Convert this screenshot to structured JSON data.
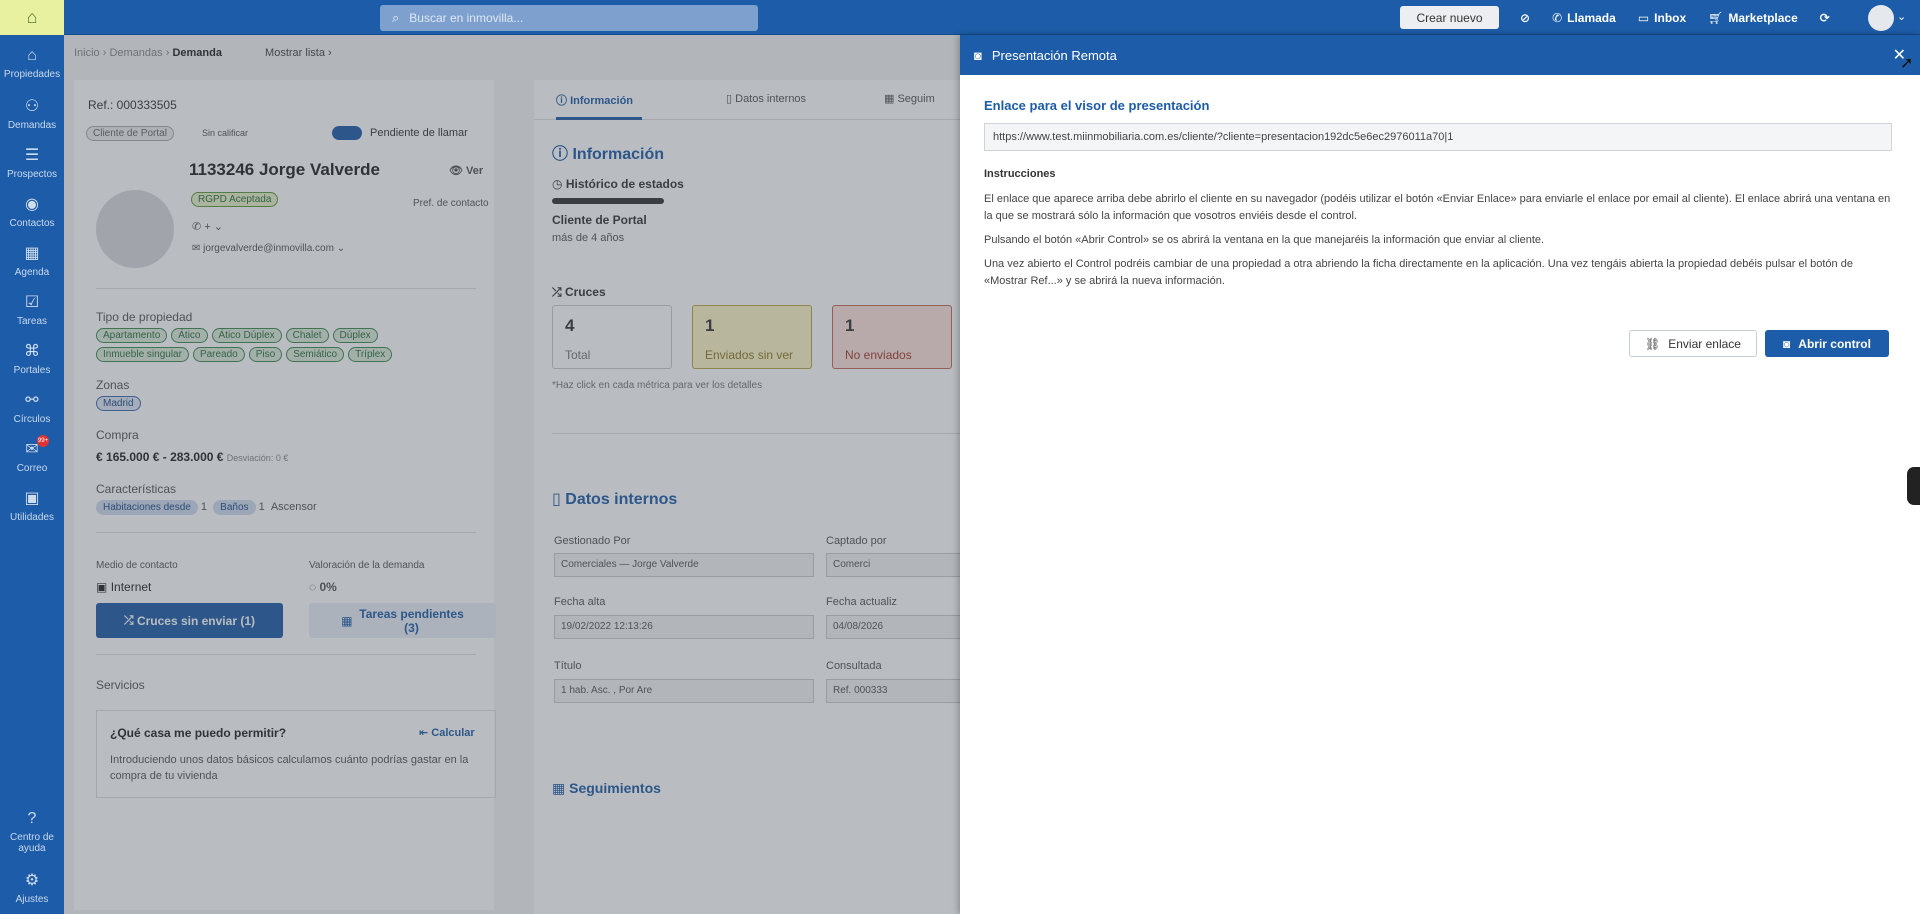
{
  "topbar": {
    "search_placeholder": "Buscar en inmovilla...",
    "create_label": "Crear nuevo",
    "actions": [
      {
        "icon": "eye-off-icon",
        "label": ""
      },
      {
        "icon": "phone-icon",
        "label": "Llamada"
      },
      {
        "icon": "inbox-icon",
        "label": "Inbox"
      },
      {
        "icon": "cart-icon",
        "label": "Marketplace"
      },
      {
        "icon": "sync-icon",
        "label": ""
      }
    ]
  },
  "sidebar": {
    "items": [
      {
        "icon": "home-icon",
        "label": "Propiedades"
      },
      {
        "icon": "users-icon",
        "label": "Demandas"
      },
      {
        "icon": "list-icon",
        "label": "Prospectos"
      },
      {
        "icon": "user-circle-icon",
        "label": "Contactos"
      },
      {
        "icon": "calendar-icon",
        "label": "Agenda"
      },
      {
        "icon": "tasks-icon",
        "label": "Tareas"
      },
      {
        "icon": "portal-icon",
        "label": "Portales"
      },
      {
        "icon": "circles-icon",
        "label": "Círculos"
      },
      {
        "icon": "mail-icon",
        "label": "Correo",
        "badge": "99+"
      },
      {
        "icon": "toolbox-icon",
        "label": "Utilidades"
      }
    ],
    "bottom": [
      {
        "icon": "help-icon",
        "label_line1": "Centro de",
        "label_line2": "ayuda"
      },
      {
        "icon": "gear-icon",
        "label": "Ajustes"
      }
    ]
  },
  "breadcrumb": {
    "part1": "Inicio",
    "part2": "Demandas",
    "current": "Demanda",
    "list_link": "Mostrar lista"
  },
  "demand": {
    "ref": "Ref.: 000333505",
    "client_tag": "Cliente de Portal",
    "rating": "Sin calificar",
    "pending_call": "Pendiente de llamar",
    "name": "1133246 Jorge Valverde",
    "view": "Ver",
    "rgpd": "RGPD Aceptada",
    "phone": "+",
    "email": "jorgevalverde@inmovilla.com",
    "pref_contact": "Pref. de contacto",
    "property_type_label": "Tipo de propiedad",
    "property_types": [
      "Apartamento",
      "Ático",
      "Ático Dúplex",
      "Chalet",
      "Dúplex",
      "Inmueble singular",
      "Pareado",
      "Piso",
      "Semiático",
      "Tríplex"
    ],
    "zones_label": "Zonas",
    "zone": "Madrid",
    "purchase_label": "Compra",
    "price_range": "165.000 € - 283.000 €",
    "deviation": "Desviación: 0 €",
    "features_label": "Características",
    "feature_rooms": "Habitaciones desde",
    "feature_rooms_val": "1",
    "feature_baths": "Baños",
    "feature_baths_val": "1",
    "feature_lift": "Ascensor",
    "contact_medium_label": "Medio de contacto",
    "contact_medium": "Internet",
    "valuation_label": "Valoración de la demanda",
    "valuation": "0%",
    "btn_cruces": "Cruces sin enviar  (1)",
    "btn_tareas_l1": "Tareas pendientes",
    "btn_tareas_l2": "(3)",
    "services_label": "Servicios",
    "afford_title": "¿Qué casa me puedo permitir?",
    "afford_calc": "Calcular",
    "afford_text": "Introduciendo unos datos básicos calculamos cuánto podrías gastar en la compra de tu vivienda"
  },
  "info": {
    "tabs": [
      "Información",
      "Datos internos",
      "Seguim"
    ],
    "title": "Información",
    "history_title": "Histórico de estados",
    "status": "Cliente de Portal",
    "status_time": "más de 4 años",
    "cruces_title": "Cruces",
    "metrics": [
      {
        "num": "4",
        "label": "Total"
      },
      {
        "num": "1",
        "label": "Enviados sin ver"
      },
      {
        "num": "1",
        "label": "No enviados"
      }
    ],
    "metrics_hint": "*Haz click en cada métrica para ver los detalles",
    "internal_title": "Datos internos",
    "managed_label": "Gestionado Por",
    "managed_value": "Comerciales — Jorge Valverde",
    "captured_label": "Captado por",
    "captured_value": "Comerci",
    "created_label": "Fecha alta",
    "created_value": "19/02/2022 12:13:26",
    "updated_label": "Fecha actualiz",
    "updated_value": "04/08/2026",
    "title_label": "Título",
    "title_value": "1 hab. Asc. , Por Are",
    "consulted_label": "Consultada",
    "consulted_value": "Ref. 000333",
    "followups_title": "Seguimientos"
  },
  "modal": {
    "title": "Presentación Remota",
    "link_title": "Enlace para el visor de presentación",
    "url": "https://www.test.miinmobiliaria.com.es/cliente/?cliente=presentacion192dc5e6ec2976011a70|1",
    "instructions_title": "Instrucciones",
    "para1": "El enlace que aparece arriba debe abrirlo el cliente en su navegador (podéis utilizar el botón «Enviar Enlace» para enviarle el enlace por email al cliente). El enlace abrirá una ventana en la que se mostrará sólo la información que vosotros enviéis desde el control.",
    "para2": "Pulsando el botón «Abrir Control» se os abrirá la ventana en la que manejaréis la información que enviar al cliente.",
    "para3": "Una vez abierto el Control podréis cambiar de una propiedad a otra abriendo la ficha directamente en la aplicación. Una vez tengáis abierta la propiedad debéis pulsar el botón de «Mostrar Ref...» y se abrirá la nueva información.",
    "btn_send": "Enviar enlace",
    "btn_open": "Abrir control"
  }
}
